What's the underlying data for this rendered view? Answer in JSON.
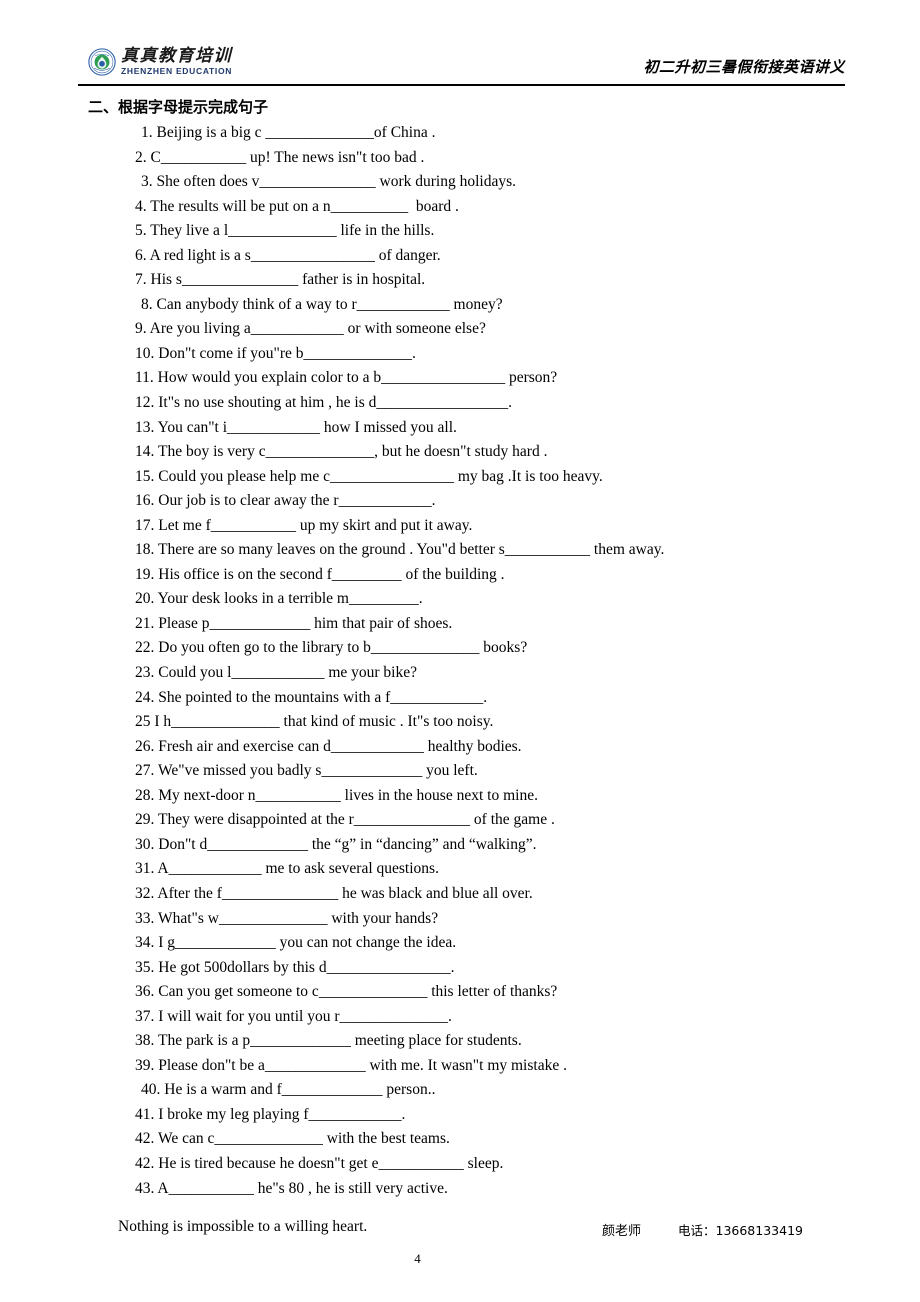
{
  "header": {
    "brand_cn": "真真教育培训",
    "brand_en": "ZHENZHEN EDUCATION",
    "logo_icon": "circular-seal-logo",
    "title": "初二升初三暑假衔接英语讲义"
  },
  "content": {
    "section_heading": "二、根据字母提示完成句子",
    "questions": [
      {
        "text": "1. Beijing is a big c ______________of China .",
        "indent": true
      },
      {
        "text": "2. C___________ up! The news isn\"t too bad .",
        "indent": false
      },
      {
        "text": "3. She often does v_______________ work during holidays.",
        "indent": true
      },
      {
        "text": "4. The results will be put on a n__________  board .",
        "indent": false
      },
      {
        "text": "5. They live a l______________ life in the hills.",
        "indent": false
      },
      {
        "text": "6. A red light is a s________________ of danger.",
        "indent": false
      },
      {
        "text": "7. His s_______________ father is in hospital.",
        "indent": false
      },
      {
        "text": "8. Can anybody think of a way to r____________ money?",
        "indent": true
      },
      {
        "text": "9. Are you living a____________ or with someone else?",
        "indent": false
      },
      {
        "text": "10. Don\"t come if you\"re b______________.",
        "indent": false
      },
      {
        "text": "11. How would you explain color to a b________________ person?",
        "indent": false
      },
      {
        "text": "12. It\"s no use shouting at him , he is d_________________.",
        "indent": false
      },
      {
        "text": "13. You can\"t i____________ how I missed you all.",
        "indent": false
      },
      {
        "text": "14. The boy is very c______________, but he doesn\"t study hard .",
        "indent": false
      },
      {
        "text": "15. Could you please help me c________________ my bag .It is too heavy.",
        "indent": false
      },
      {
        "text": "16. Our job is to clear away the r____________.",
        "indent": false
      },
      {
        "text": "17. Let me f___________ up my skirt and put it away.",
        "indent": false
      },
      {
        "text": "18. There are so many leaves on the ground . You\"d better s___________ them away.",
        "indent": false
      },
      {
        "text": "19. His office is on the second f_________ of the building .",
        "indent": false
      },
      {
        "text": "20. Your desk looks in a terrible m_________.",
        "indent": false
      },
      {
        "text": "21. Please p_____________ him that pair of shoes.",
        "indent": false
      },
      {
        "text": "22. Do you often go to the library to b______________ books?",
        "indent": false
      },
      {
        "text": "23. Could you l____________ me your bike?",
        "indent": false
      },
      {
        "text": "24. She pointed to the mountains with a f____________.",
        "indent": false
      },
      {
        "text": "25 I h______________ that kind of music . It\"s too noisy.",
        "indent": false
      },
      {
        "text": "26. Fresh air and exercise can d____________ healthy bodies.",
        "indent": false
      },
      {
        "text": "27. We\"ve missed you badly s_____________ you left.",
        "indent": false
      },
      {
        "text": "28. My next-door n___________ lives in the house next to mine.",
        "indent": false
      },
      {
        "text": "29. They were disappointed at the r_______________ of the game .",
        "indent": false
      },
      {
        "text": "30. Don\"t d_____________ the “g” in “dancing” and “walking”.",
        "indent": false
      },
      {
        "text": "31. A____________ me to ask several questions.",
        "indent": false
      },
      {
        "text": "32. After the f_______________ he was black and blue all over.",
        "indent": false
      },
      {
        "text": "33. What\"s w______________ with your hands?",
        "indent": false
      },
      {
        "text": "34. I g_____________ you can not change the idea.",
        "indent": false
      },
      {
        "text": "35. He got 500dollars by this d________________.",
        "indent": false
      },
      {
        "text": "36. Can you get someone to c______________ this letter of thanks?",
        "indent": false
      },
      {
        "text": "37. I will wait for you until you r______________.",
        "indent": false
      },
      {
        "text": "38. The park is a p_____________ meeting place for students.",
        "indent": false
      },
      {
        "text": "39. Please don\"t be a_____________ with me. It wasn\"t my mistake .",
        "indent": false
      },
      {
        "text": "40. He is a warm and f_____________ person..",
        "indent": true
      },
      {
        "text": "41. I broke my leg playing f____________.",
        "indent": false
      },
      {
        "text": "42. We can c______________ with the best teams.",
        "indent": false
      },
      {
        "text": "42. He is tired because he doesn\"t get e___________ sleep.",
        "indent": false
      },
      {
        "text": "43. A___________ he\"s 80 , he is still very active.",
        "indent": false
      }
    ]
  },
  "footer": {
    "motto": "Nothing is impossible to a willing heart.",
    "teacher": "颜老师",
    "phone": "电话：13668133419",
    "page_number": "4"
  },
  "colors": {
    "text": "#000000",
    "brand_blue": "#1f3a6e",
    "seal_ring": "#2b5fa8",
    "seal_inner": "#2f9e55",
    "background": "#ffffff"
  }
}
